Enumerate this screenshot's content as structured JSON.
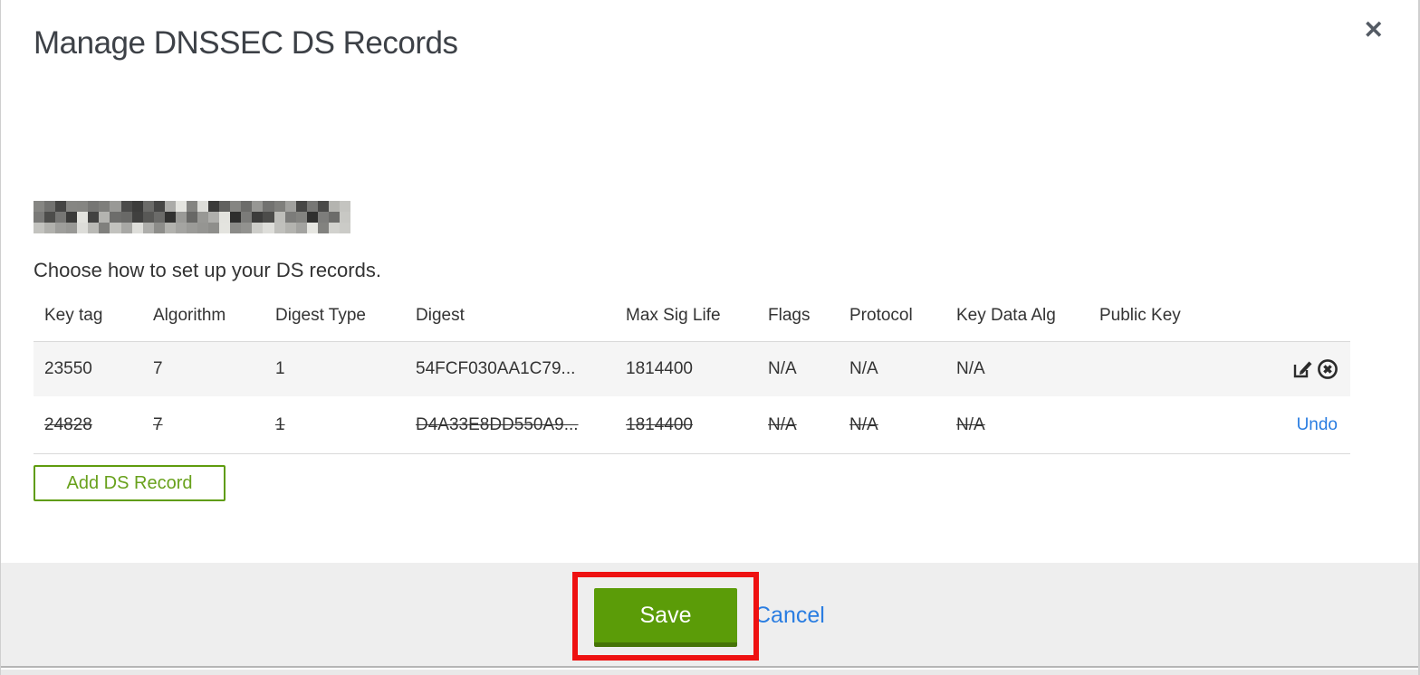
{
  "modal": {
    "title": "Manage DNSSEC DS Records",
    "close_label": "✕",
    "instruction": "Choose how to set up your DS records.",
    "table": {
      "columns": [
        "Key tag",
        "Algorithm",
        "Digest Type",
        "Digest",
        "Max Sig Life",
        "Flags",
        "Protocol",
        "Key Data Alg",
        "Public Key"
      ],
      "rows": [
        {
          "key_tag": "23550",
          "algorithm": "7",
          "digest_type": "1",
          "digest": "54FCF030AA1C79...",
          "max_sig_life": "1814400",
          "flags": "N/A",
          "protocol": "N/A",
          "key_data_alg": "N/A",
          "public_key": "",
          "state": "active",
          "actions": [
            "edit",
            "delete"
          ]
        },
        {
          "key_tag": "24828",
          "algorithm": "7",
          "digest_type": "1",
          "digest": "D4A33E8DD550A9...",
          "max_sig_life": "1814400",
          "flags": "N/A",
          "protocol": "N/A",
          "key_data_alg": "N/A",
          "public_key": "",
          "state": "marked-for-deletion",
          "undo_label": "Undo"
        }
      ]
    },
    "add_button_label": "Add DS Record",
    "footer": {
      "save_label": "Save",
      "cancel_label": "Cancel"
    },
    "colors": {
      "save_green": "#5b9c08",
      "save_green_dark": "#457307",
      "add_outline_green": "#5f9c0e",
      "link_blue": "#2a7de1",
      "annotation_red": "#ee1111",
      "row_alt_bg": "#f5f5f5",
      "footer_bg": "#eeeeee"
    }
  }
}
